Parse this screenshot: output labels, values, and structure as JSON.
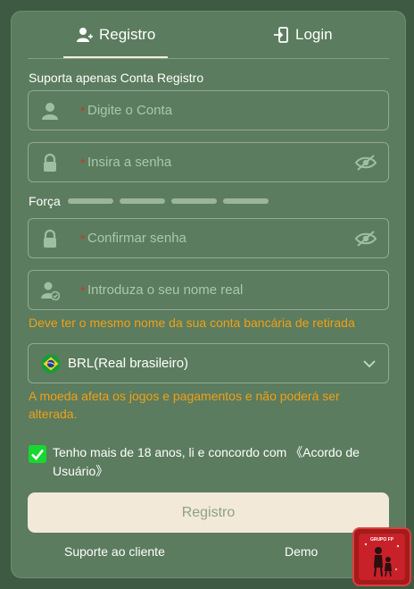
{
  "tabs": [
    {
      "label": "Registro",
      "icon": "user-add-icon",
      "active": true
    },
    {
      "label": "Login",
      "icon": "login-door-icon",
      "active": false
    }
  ],
  "form": {
    "section_title": "Suporta apenas Conta Registro",
    "required_mark": "*",
    "account": {
      "placeholder": "Digite o Conta",
      "icon": "user-icon"
    },
    "password": {
      "placeholder": "Insira a senha",
      "icon": "lock-icon"
    },
    "strength_label": "Força",
    "confirm_password": {
      "placeholder": "Confirmar senha",
      "icon": "lock-icon"
    },
    "real_name": {
      "placeholder": "Introduza o seu nome real",
      "icon": "user-check-icon"
    },
    "real_name_hint": "Deve ter o mesmo nome da sua conta bancária de retirada",
    "currency": {
      "value": "BRL(Real brasileiro)",
      "icon": "brazil-flag-icon"
    },
    "currency_hint": "A moeda afeta os jogos e pagamentos e não poderá ser alterada.",
    "agreement_text": "Tenho mais de 18 anos, li e concordo com 《Acordo de Usuário》",
    "agreement_checked": true,
    "submit_label": "Registro"
  },
  "footer": {
    "support_label": "Suporte ao cliente",
    "demo_label": "Demo"
  },
  "badge": {
    "text": "GRUPO FP"
  },
  "colors": {
    "panel": "#5b7c5e",
    "hint": "#f0a018",
    "required": "#c23a2e",
    "checkbox": "#16d82f",
    "submit_bg": "#f2e9d8"
  }
}
